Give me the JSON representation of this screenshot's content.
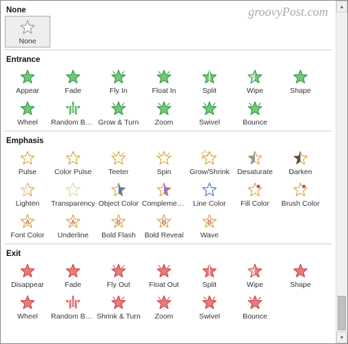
{
  "watermark": "groovyPost.com",
  "sections": [
    {
      "title": "None",
      "items": [
        {
          "label": "None",
          "style": "none",
          "selected": true
        }
      ]
    },
    {
      "title": "Entrance",
      "items": [
        {
          "label": "Appear",
          "style": "green-solid"
        },
        {
          "label": "Fade",
          "style": "green-fade-solid"
        },
        {
          "label": "Fly In",
          "style": "green-solid-marks"
        },
        {
          "label": "Float In",
          "style": "green-solid-marks"
        },
        {
          "label": "Split",
          "style": "green-split"
        },
        {
          "label": "Wipe",
          "style": "green-half-fade"
        },
        {
          "label": "Shape",
          "style": "green-solid"
        },
        {
          "label": "Wheel",
          "style": "green-solid"
        },
        {
          "label": "Random Bars",
          "style": "green-bars"
        },
        {
          "label": "Grow & Turn",
          "style": "green-solid-marks"
        },
        {
          "label": "Zoom",
          "style": "green-solid-marks"
        },
        {
          "label": "Swivel",
          "style": "green-solid-marks"
        },
        {
          "label": "Bounce",
          "style": "green-solid-marks"
        }
      ]
    },
    {
      "title": "Emphasis",
      "items": [
        {
          "label": "Pulse",
          "style": "yellow-outline"
        },
        {
          "label": "Color Pulse",
          "style": "yellow-outline"
        },
        {
          "label": "Teeter",
          "style": "yellow-outline-marks"
        },
        {
          "label": "Spin",
          "style": "yellow-outline-marks"
        },
        {
          "label": "Grow/Shrink",
          "style": "yellow-double"
        },
        {
          "label": "Desaturate",
          "style": "yellow-grey-half"
        },
        {
          "label": "Darken",
          "style": "yellow-dark-half"
        },
        {
          "label": "Lighten",
          "style": "yellow-light-half"
        },
        {
          "label": "Transparency",
          "style": "yellow-outline-faint"
        },
        {
          "label": "Object Color",
          "style": "yellow-blue-half"
        },
        {
          "label": "Complemen...",
          "style": "yellow-purple-half"
        },
        {
          "label": "Line Color",
          "style": "yellow-blue-line"
        },
        {
          "label": "Fill Color",
          "style": "yellow-red-dot"
        },
        {
          "label": "Brush Color",
          "style": "yellow-red-dot"
        },
        {
          "label": "Font Color",
          "style": "yellow-outline-a"
        },
        {
          "label": "Underline",
          "style": "yellow-outline-a"
        },
        {
          "label": "Bold Flash",
          "style": "yellow-outline-b"
        },
        {
          "label": "Bold Reveal",
          "style": "yellow-outline-b"
        },
        {
          "label": "Wave",
          "style": "yellow-outline-b"
        }
      ]
    },
    {
      "title": "Exit",
      "items": [
        {
          "label": "Disappear",
          "style": "red-solid"
        },
        {
          "label": "Fade",
          "style": "red-fade-solid"
        },
        {
          "label": "Fly Out",
          "style": "red-solid-marks"
        },
        {
          "label": "Float Out",
          "style": "red-solid-marks"
        },
        {
          "label": "Split",
          "style": "red-split"
        },
        {
          "label": "Wipe",
          "style": "red-half-fade"
        },
        {
          "label": "Shape",
          "style": "red-solid"
        },
        {
          "label": "Wheel",
          "style": "red-solid"
        },
        {
          "label": "Random Bars",
          "style": "red-bars"
        },
        {
          "label": "Shrink & Turn",
          "style": "red-solid-marks"
        },
        {
          "label": "Zoom",
          "style": "red-solid-marks"
        },
        {
          "label": "Swivel",
          "style": "red-solid-marks"
        },
        {
          "label": "Bounce",
          "style": "red-solid-marks"
        }
      ]
    }
  ]
}
